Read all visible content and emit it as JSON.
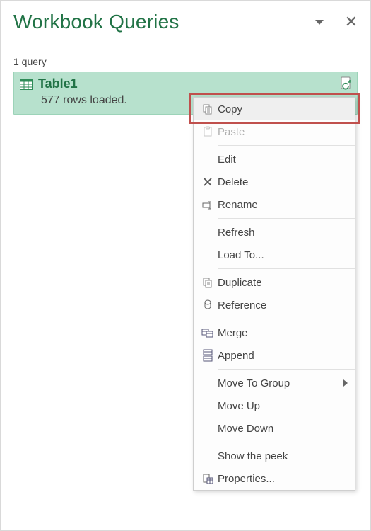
{
  "panel": {
    "title": "Workbook Queries",
    "count_label": "1 query"
  },
  "query": {
    "name": "Table1",
    "status": "577 rows loaded."
  },
  "menu": {
    "copy": "Copy",
    "paste": "Paste",
    "edit": "Edit",
    "delete": "Delete",
    "rename": "Rename",
    "refresh": "Refresh",
    "load_to": "Load To...",
    "duplicate": "Duplicate",
    "reference": "Reference",
    "merge": "Merge",
    "append": "Append",
    "move_to_group": "Move To Group",
    "move_up": "Move Up",
    "move_down": "Move Down",
    "show_peek": "Show the peek",
    "properties": "Properties..."
  }
}
